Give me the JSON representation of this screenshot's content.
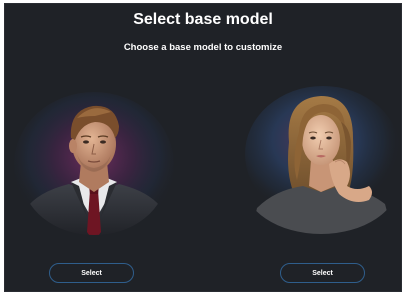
{
  "header": {
    "title": "Select base model",
    "subtitle": "Choose a base model to customize"
  },
  "models": [
    {
      "name": "male-model",
      "button_label": "Select"
    },
    {
      "name": "female-model",
      "button_label": "Select"
    }
  ],
  "colors": {
    "background": "#1f2227",
    "button_border": "#2f5e8c",
    "text": "#ffffff"
  }
}
